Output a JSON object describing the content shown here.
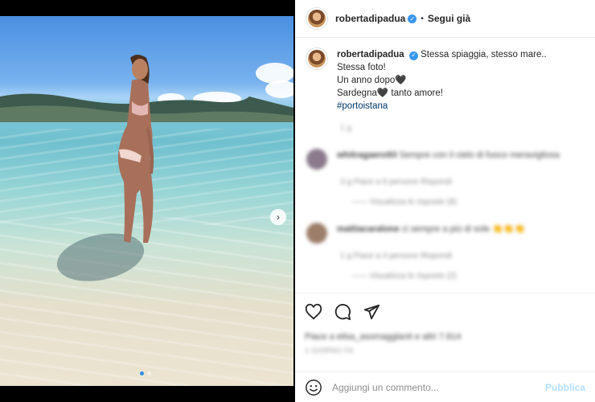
{
  "post": {
    "username": "robertadipadua",
    "follow_label": "Segui già",
    "separator": "•",
    "caption": {
      "line1": "Stessa spiaggia, stesso mare..",
      "line2": "Stessa foto!",
      "line3": "Un anno dopo🖤",
      "line4": "Sardegna🖤 tanto amore!",
      "hashtag": "#portoistana"
    },
    "caption_time": "1 g",
    "comments": [
      {
        "username": "whitragaero93",
        "text": "Sempre con il cielo di fuoco meravigliosa",
        "meta": "3 g   Piace a 6 persone   Rispondi",
        "replies": "——   Visualizza le risposte (8)",
        "avatar_color": "#8a7a8c"
      },
      {
        "username": "mattiacaralone",
        "text": "ci sempre a più di sole 👏👏👏",
        "meta": "1 g   Piace a 4 persone   Rispondi",
        "replies": "——   Visualizza le risposte (2)",
        "avatar_color": "#9c7e6a"
      }
    ],
    "likes": "Piace a elisa_asomagglanti e altri 7.814",
    "date": "1 GIORNO FA"
  },
  "composer": {
    "placeholder": "Aggiungi un commento...",
    "publish_label": "Pubblica"
  },
  "carousel": {
    "slides": 2,
    "active_index": 0
  },
  "icons": {
    "like": "heart-icon",
    "comment": "comment-icon",
    "share": "send-icon",
    "emoji": "emoji-icon",
    "next": "chevron-right-icon"
  },
  "colors": {
    "accent": "#3897f0",
    "hashtag": "#00376b"
  }
}
